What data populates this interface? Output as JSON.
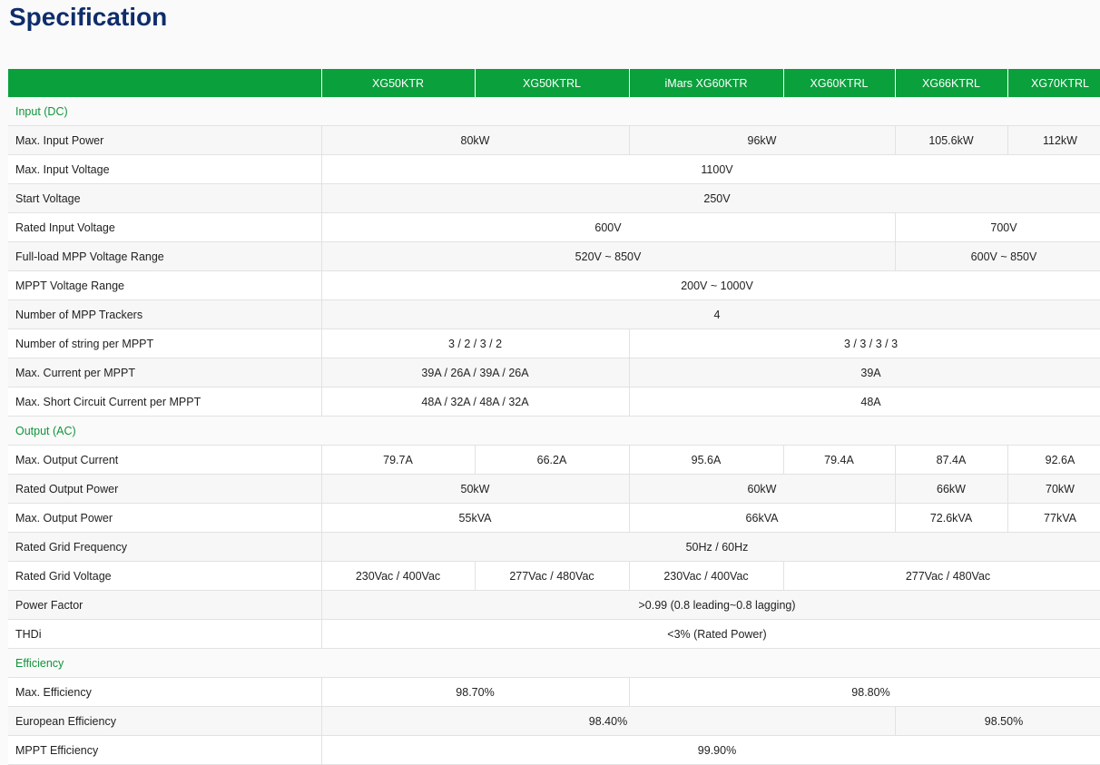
{
  "title": "Specification",
  "models": [
    "XG50KTR",
    "XG50KTRL",
    "iMars XG60KTR",
    "XG60KTRL",
    "XG66KTRL",
    "XG70KTRL"
  ],
  "sections": {
    "input": "Input (DC)",
    "output": "Output (AC)",
    "efficiency": "Efficiency"
  },
  "rows": {
    "max_input_power": {
      "label": "Max. Input Power",
      "v": [
        "80kW",
        "96kW",
        "105.6kW",
        "112kW"
      ]
    },
    "max_input_voltage": {
      "label": "Max. Input Voltage",
      "v": [
        "1100V"
      ]
    },
    "start_voltage": {
      "label": "Start Voltage",
      "v": [
        "250V"
      ]
    },
    "rated_input_voltage": {
      "label": "Rated Input Voltage",
      "v": [
        "600V",
        "700V"
      ]
    },
    "full_load_mpp": {
      "label": "Full-load MPP Voltage Range",
      "v": [
        "520V ~ 850V",
        "600V ~ 850V"
      ]
    },
    "mppt_voltage_range": {
      "label": "MPPT Voltage Range",
      "v": [
        "200V ~ 1000V"
      ]
    },
    "mpp_trackers": {
      "label": "Number of MPP Trackers",
      "v": [
        "4"
      ]
    },
    "strings_per_mppt": {
      "label": "Number of string per MPPT",
      "v": [
        "3 / 2 / 3 / 2",
        "3 / 3 / 3 / 3"
      ]
    },
    "max_current_mppt": {
      "label": "Max. Current per MPPT",
      "v": [
        "39A / 26A / 39A / 26A",
        "39A"
      ]
    },
    "max_sc_current": {
      "label": "Max. Short Circuit Current per MPPT",
      "v": [
        "48A / 32A / 48A / 32A",
        "48A"
      ]
    },
    "max_output_current": {
      "label": "Max. Output Current",
      "v": [
        "79.7A",
        "66.2A",
        "95.6A",
        "79.4A",
        "87.4A",
        "92.6A"
      ]
    },
    "rated_output_power": {
      "label": "Rated Output Power",
      "v": [
        "50kW",
        "60kW",
        "66kW",
        "70kW"
      ]
    },
    "max_output_power": {
      "label": "Max. Output Power",
      "v": [
        "55kVA",
        "66kVA",
        "72.6kVA",
        "77kVA"
      ]
    },
    "rated_grid_freq": {
      "label": "Rated Grid Frequency",
      "v": [
        "50Hz / 60Hz"
      ]
    },
    "rated_grid_voltage": {
      "label": "Rated Grid Voltage",
      "v": [
        "230Vac / 400Vac",
        "277Vac / 480Vac",
        "230Vac / 400Vac",
        "277Vac / 480Vac"
      ]
    },
    "power_factor": {
      "label": "Power Factor",
      "v": [
        ">0.99 (0.8 leading~0.8 lagging)"
      ]
    },
    "thdi": {
      "label": "THDi",
      "v": [
        "<3% (Rated Power)"
      ]
    },
    "max_efficiency": {
      "label": "Max. Efficiency",
      "v": [
        "98.70%",
        "98.80%"
      ]
    },
    "european_efficiency": {
      "label": "European Efficiency",
      "v": [
        "98.40%",
        "98.50%"
      ]
    },
    "mppt_efficiency": {
      "label": "MPPT Efficiency",
      "v": [
        "99.90%"
      ]
    }
  },
  "colors": {
    "header_green": "#0aa03c",
    "section_green": "#12943a",
    "title_navy": "#0f2d6b"
  }
}
